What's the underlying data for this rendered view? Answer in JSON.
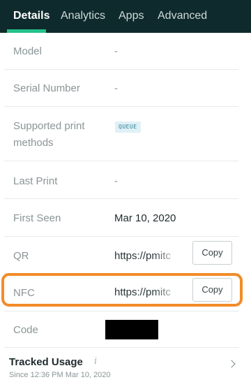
{
  "tabs": [
    {
      "label": "Details",
      "active": true
    },
    {
      "label": "Analytics",
      "active": false
    },
    {
      "label": "Apps",
      "active": false
    },
    {
      "label": "Advanced",
      "active": false
    }
  ],
  "details": {
    "model": {
      "label": "Model",
      "value": "-"
    },
    "serial": {
      "label": "Serial Number",
      "value": "-"
    },
    "print_methods": {
      "label_line1": "Supported print",
      "label_line2": "methods",
      "badge": "QUEUE"
    },
    "last_print": {
      "label": "Last Print",
      "value": "-"
    },
    "first_seen": {
      "label": "First Seen",
      "value": "Mar 10, 2020"
    },
    "qr": {
      "label": "QR",
      "url": "https://pmitc",
      "copy_label": "Copy"
    },
    "nfc": {
      "label": "NFC",
      "url": "https://pmitc",
      "copy_label": "Copy"
    },
    "code": {
      "label": "Code"
    }
  },
  "tracked_usage": {
    "title": "Tracked Usage",
    "info_icon": "i",
    "since": "Since 12:36 PM Mar 10, 2020"
  },
  "colors": {
    "tab_bar_bg": "#0f2a2c",
    "tab_active_indicator": "#24c28a",
    "highlight_outline": "#f28c28",
    "badge_bg": "#dff1f6",
    "badge_text": "#2e7f98"
  }
}
